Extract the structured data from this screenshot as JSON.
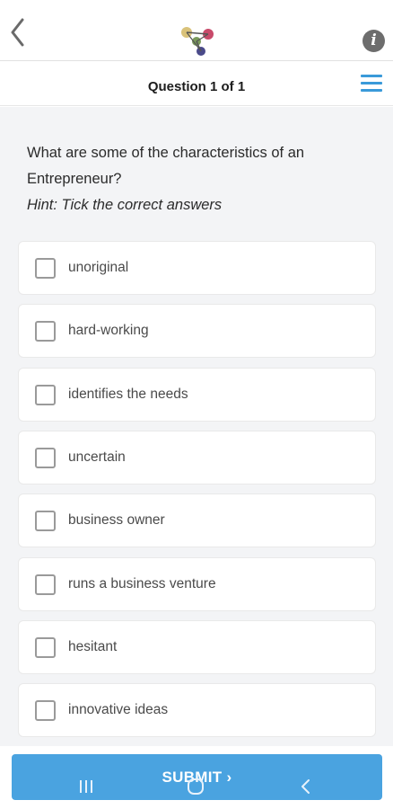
{
  "header": {
    "back_icon": "chevron-left-icon",
    "logo_icon": "app-logo-icon",
    "info_glyph": "i"
  },
  "subheader": {
    "counter": "Question 1 of 1",
    "menu_icon": "hamburger-menu-icon",
    "accent": "#3a9ad9"
  },
  "question": {
    "text": "What are some of the characteristics of an Entrepreneur?",
    "hint": "Hint: Tick the correct answers"
  },
  "options": [
    {
      "label": "unoriginal",
      "checked": false
    },
    {
      "label": "hard-working",
      "checked": false
    },
    {
      "label": "identifies the needs",
      "checked": false
    },
    {
      "label": "uncertain",
      "checked": false
    },
    {
      "label": "business owner",
      "checked": false
    },
    {
      "label": "runs a business venture",
      "checked": false
    },
    {
      "label": "hesitant",
      "checked": false
    },
    {
      "label": "innovative ideas",
      "checked": false
    }
  ],
  "footer": {
    "submit_label": "SUBMIT ›",
    "submit_color": "#4aa3e0",
    "nav_icons": [
      "recent-apps-icon",
      "home-icon",
      "system-back-icon"
    ]
  }
}
